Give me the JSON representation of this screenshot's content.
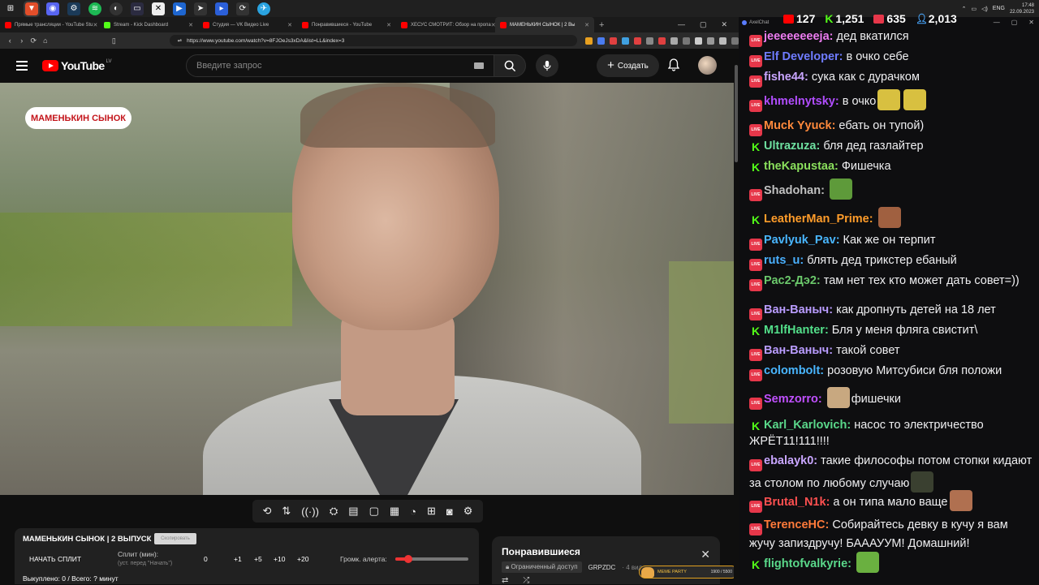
{
  "taskbar": {
    "tray_lang": "ENG",
    "clock_time": "17:48",
    "clock_date": "22.09.2023",
    "icons": [
      "windows-logo-icon",
      "brave-icon",
      "discord-icon",
      "steam-icon",
      "spotify-icon",
      "obs-icon",
      "app-icon",
      "capcut-icon",
      "app-icon",
      "app-icon",
      "app-icon",
      "app-icon",
      "telegram-icon"
    ]
  },
  "browser": {
    "tabs": [
      {
        "label": "Прямые трансляции - YouTube Stu",
        "favicon_color": "#ff0000"
      },
      {
        "label": "Stream - Kick Dashboard",
        "favicon_color": "#53fc18"
      },
      {
        "label": "Студия — VK Видео Live",
        "favicon_color": "#ff0000"
      },
      {
        "label": "Понравившиеся - YouTube",
        "favicon_color": "#ff0000"
      },
      {
        "label": "ХЕСУС СМОТРИТ: Обзор на пропа",
        "favicon_color": "#ff0000"
      },
      {
        "label": "МАМЕНЬКИН СЫНОК | 2 Вы",
        "favicon_color": "#ff0000"
      }
    ],
    "url": "https://www.youtube.com/watch?v=8FJOeJs3xDA&list=LL&index=3"
  },
  "youtube": {
    "logo_text": "YouTube",
    "logo_country": "LV",
    "search_placeholder": "Введите запрос",
    "create_label": "Создать"
  },
  "video": {
    "badge_text": "МАМЕНЬКИН СЫНОК"
  },
  "split_panel": {
    "title": "МАМЕНЬКИН СЫНОК | 2 ВЫПУСК",
    "copy_label": "Скопировать",
    "start_split": "НАЧАТЬ СПЛИТ",
    "split_min_label": "Сплит (мин):",
    "split_hint": "(уст. перед \"Начать\")",
    "split_value": "0",
    "steps": [
      "+1",
      "+5",
      "+10",
      "+20"
    ],
    "alert_volume_label": "Громк. алерта:",
    "alert_volume": 0.18,
    "bought_text": "Выкуплено: 0 / Всего: ? минут"
  },
  "playlist_panel": {
    "title": "Понравившиеся",
    "restricted_label": "Ограниченный доступ",
    "owner": "GRPZDC",
    "count": "· 4 видео"
  },
  "meme_party": {
    "label": "MEME PARTY",
    "progress_text": "1900 / 5500"
  },
  "chat": {
    "window_title": "AxelChat",
    "stats": [
      {
        "platform": "youtube",
        "color": "#ff0000",
        "value": "127"
      },
      {
        "platform": "kick",
        "color": "#53fc18",
        "value": "1,251"
      },
      {
        "platform": "vk",
        "color": "#e6374a",
        "value": "635"
      },
      {
        "platform": "total",
        "color": "#4aa8ff",
        "value": "2,013"
      }
    ],
    "messages": [
      {
        "platform": "vk",
        "user": "jeeeeeeeeja",
        "color": "#ec7cf0",
        "text": "дед вкатился"
      },
      {
        "platform": "vk",
        "user": "Elf Developer",
        "color": "#6f7cff",
        "text": "в очко себе"
      },
      {
        "platform": "vk",
        "user": "fishe44",
        "color": "#c9a6ff",
        "text": "сука как с дурачком"
      },
      {
        "platform": "vk",
        "user": "khmelnytsky",
        "color": "#b14dff",
        "text": "в очко",
        "emotes": [
          "#d8c040",
          "#d8c040"
        ]
      },
      {
        "platform": "vk",
        "user": "Muck Yyuck",
        "color": "#ff8a3c",
        "text": "ебать он тупой)"
      },
      {
        "platform": "kick",
        "user": "Ultrazuza",
        "color": "#6ee0a0",
        "text": "бля дед газлайтер"
      },
      {
        "platform": "kick",
        "user": "theKapustaa",
        "color": "#8adf5c",
        "text": "Фишечка"
      },
      {
        "platform": "vk",
        "user": "Shadohan",
        "color": "#c0c0c0",
        "text": "",
        "emotes": [
          "#5e9a3a"
        ]
      },
      {
        "platform": "kick",
        "user": "LeatherMan_Prime",
        "color": "#ff9c2a",
        "text": "",
        "emotes": [
          "#a06040"
        ]
      },
      {
        "platform": "vk",
        "user": "Pavlyuk_Pav",
        "color": "#49b6ff",
        "text": "Как же он терпит"
      },
      {
        "platform": "vk",
        "user": "ruts_u",
        "color": "#4ab0ff",
        "text": "блять дед трикстер ебаный"
      },
      {
        "platform": "vk",
        "user": "Рас2-Дэ2",
        "color": "#6bc86b",
        "text": "там нет тех кто может дать совет=))"
      },
      {
        "platform": "vk",
        "user": "Ван-Ваныч",
        "color": "#b99cff",
        "text": "как дропнуть детей на 18 лет"
      },
      {
        "platform": "kick",
        "user": "M1lfHanter",
        "color": "#53e08a",
        "text": "Бля у меня фляга свистит\\"
      },
      {
        "platform": "vk",
        "user": "Ван-Ваныч",
        "color": "#b99cff",
        "text": "такой совет"
      },
      {
        "platform": "vk",
        "user": "colombolt",
        "color": "#49b6ff",
        "text": "розовую Митсубиси бля положи"
      },
      {
        "platform": "vk",
        "user": "Semzorro",
        "color": "#c050ff",
        "text": "фишечки",
        "emote_before_text": true,
        "emotes": [
          "#c8a880"
        ]
      },
      {
        "platform": "kick",
        "user": "Karl_Karlovich",
        "color": "#5ad88a",
        "text": "насос то электричество ЖРЁТ11!111!!!!"
      },
      {
        "platform": "vk",
        "user": "ebalayk0",
        "color": "#c9a6ff",
        "text": "такие философы потом стопки кидают за столом по любому случаю",
        "emotes": [
          "#3a4030"
        ]
      },
      {
        "platform": "vk",
        "user": "Brutal_N1k",
        "color": "#ff5050",
        "text": "а он типа мало ваще",
        "emotes": [
          "#b07050"
        ]
      },
      {
        "platform": "vk",
        "user": "TerenceHC",
        "color": "#ff7a3a",
        "text": "Собирайтесь девку в кучу я вам жучу запиздручу! БАААУУМ! Домашний!"
      },
      {
        "platform": "kick",
        "user": "flightofvalkyrie",
        "color": "#5ad88a",
        "text": "",
        "emotes": [
          "#6ab040"
        ]
      }
    ]
  }
}
